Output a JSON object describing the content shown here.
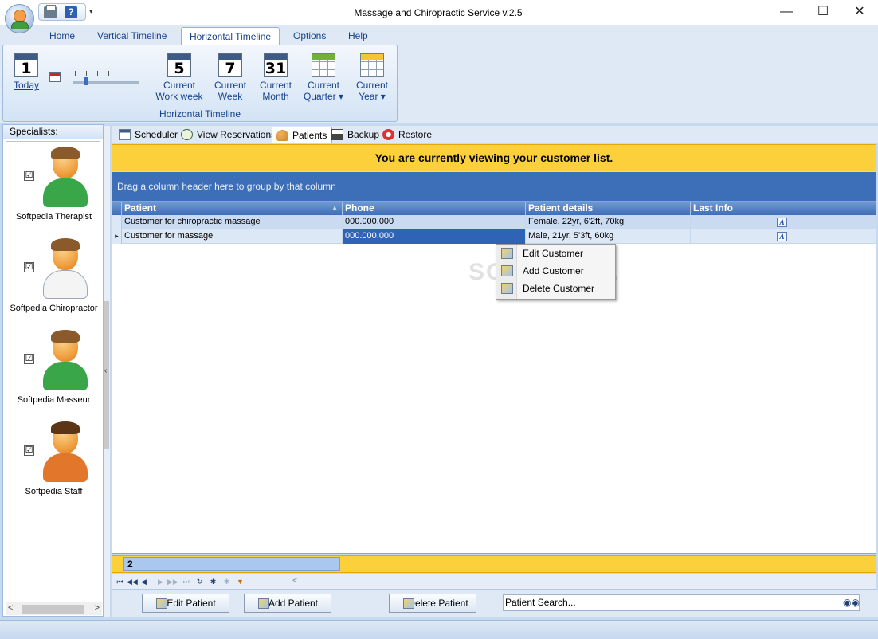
{
  "window": {
    "title": "Massage and Chiropractic Service v.2.5",
    "controls": {
      "minimize": "—",
      "maximize": "☐",
      "close": "✕"
    }
  },
  "quick_access": {
    "help": "?",
    "more": "▾"
  },
  "ribbon": {
    "tabs": [
      {
        "label": "Home",
        "active": false
      },
      {
        "label": "Vertical Timeline",
        "active": false
      },
      {
        "label": "Horizontal Timeline",
        "active": true
      },
      {
        "label": "Options",
        "active": false
      },
      {
        "label": "Help",
        "active": false
      }
    ],
    "today": {
      "number": "1",
      "label": "Today"
    },
    "buttons": [
      {
        "number": "5",
        "line1": "Current",
        "line2": "Work week",
        "icon": "calendar-icon"
      },
      {
        "number": "7",
        "line1": "Current",
        "line2": "Week",
        "icon": "calendar-icon"
      },
      {
        "number": "31",
        "line1": "Current",
        "line2": "Month",
        "icon": "calendar-icon"
      },
      {
        "line1": "Current",
        "line2": "Quarter ▾",
        "icon": "grid-calendar-icon",
        "header_color": "#6fb13d"
      },
      {
        "line1": "Current",
        "line2": "Year ▾",
        "icon": "grid-calendar-icon",
        "header_color": "#f2c53a"
      }
    ],
    "group_label": "Horizontal Timeline"
  },
  "specialists": {
    "header": "Specialists:",
    "items": [
      {
        "name": "Softpedia Therapist",
        "checked": "☑",
        "shirt_color": "#3aa64a"
      },
      {
        "name": "Softpedia Chiropractor",
        "checked": "☑",
        "shirt_color": "#ffffff"
      },
      {
        "name": "Softpedia Masseur",
        "checked": "☑",
        "shirt_color": "#3aa64a"
      },
      {
        "name": "Softpedia Staff",
        "checked": "☑",
        "shirt_color": "#e2762a"
      }
    ]
  },
  "subtabs": [
    {
      "label": "Scheduler",
      "active": false,
      "icon": "calendar-icon"
    },
    {
      "label": "View Reservations",
      "active": false,
      "icon": "clock-icon"
    },
    {
      "label": "Patients",
      "active": true,
      "icon": "people-icon"
    },
    {
      "label": "Backup",
      "active": false,
      "icon": "disk-icon"
    },
    {
      "label": "Restore",
      "active": false,
      "icon": "lifebuoy-icon"
    }
  ],
  "banner": "You are currently viewing your customer list.",
  "group_hint": "Drag a column header here to group by that column",
  "grid": {
    "columns": [
      "Patient",
      "Phone",
      "Patient details",
      "Last Info"
    ],
    "sort_indicator": "▲",
    "rows": [
      {
        "patient": "Customer for chiropractic massage",
        "phone": "000.000.000",
        "details": "Female, 22yr, 6'2ft, 70kg",
        "info": "A"
      },
      {
        "patient": "Customer for massage",
        "phone": "000.000.000",
        "details": "Male, 21yr, 5'3ft, 60kg",
        "info": "A"
      }
    ],
    "current_row_marker": "▸"
  },
  "context_menu": [
    "Edit Customer",
    "Add Customer",
    "Delete Customer"
  ],
  "watermark": "SOFTPEDIA",
  "summary_count": "2",
  "navigator": [
    "⏮",
    "◀◀",
    "◀",
    "▶",
    "▶▶",
    "⏭",
    "↻",
    "✱",
    "✱",
    "▼"
  ],
  "bottom_buttons": {
    "edit": "Edit Patient",
    "add": "Add Patient",
    "delete": "Delete Patient"
  },
  "search": {
    "placeholder": "Patient Search..."
  }
}
